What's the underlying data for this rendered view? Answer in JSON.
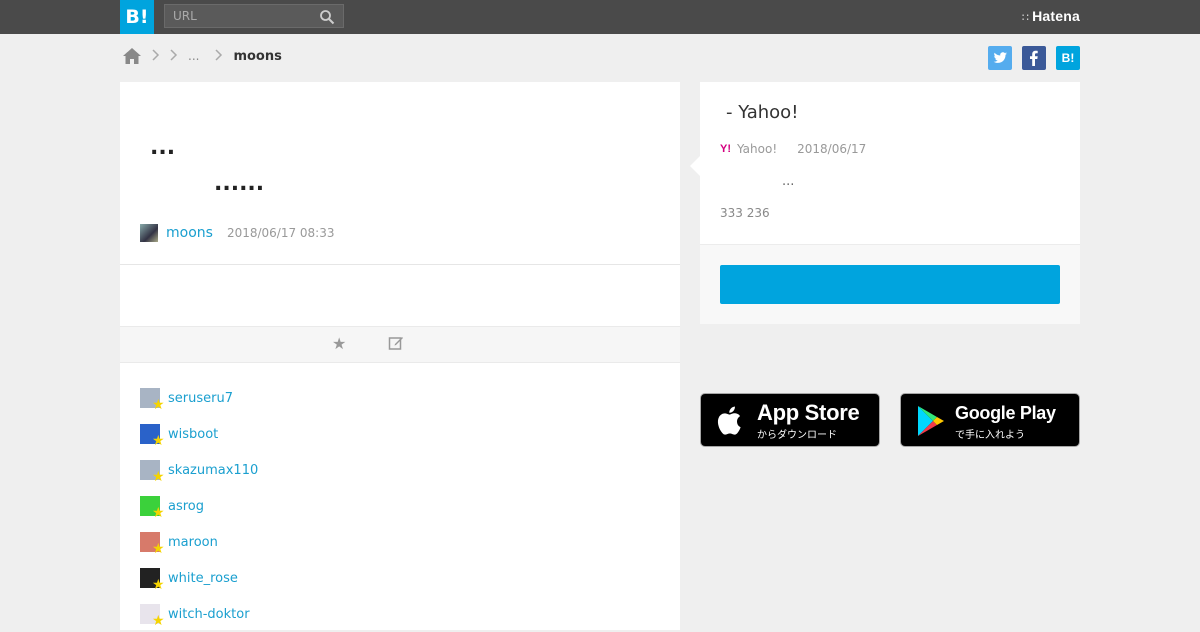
{
  "topbar": {
    "logo_text": "B!",
    "search_placeholder": "URL",
    "brand": "Hatena",
    "brand_dots": "∷"
  },
  "breadcrumb": {
    "ellipsis": "...",
    "current": "moons"
  },
  "share": {
    "twitter": "t",
    "facebook": "f",
    "hatena": "B!"
  },
  "comment": {
    "line1": "...",
    "line2": "......",
    "user": "moons",
    "date": "2018/06/17 08:33"
  },
  "stars": [
    {
      "name": "seruseru7",
      "avatar_color": "#a8b4c4"
    },
    {
      "name": "wisboot",
      "avatar_color": "#2a62c9"
    },
    {
      "name": "skazumax110",
      "avatar_color": "#a8b4c4"
    },
    {
      "name": "asrog",
      "avatar_color": "#3bd13b"
    },
    {
      "name": "maroon",
      "avatar_color": "#d77a6a"
    },
    {
      "name": "white_rose",
      "avatar_color": "#222222"
    },
    {
      "name": "witch-doktor",
      "avatar_color": "#e8e4ec"
    }
  ],
  "entry": {
    "title": "- Yahoo!",
    "source_icon": "Y!",
    "source": "Yahoo!",
    "date": "2018/06/17",
    "desc": "...",
    "counts": "333 236"
  },
  "stores": {
    "apple_big": "App Store",
    "apple_small": "からダウンロード",
    "google_big": "Google Play",
    "google_small": "で手に入れよう"
  },
  "colors": {
    "accent": "#00a4de",
    "link": "#1a9fcf",
    "topbar": "#4a4a4a",
    "star": "#f5d400"
  }
}
